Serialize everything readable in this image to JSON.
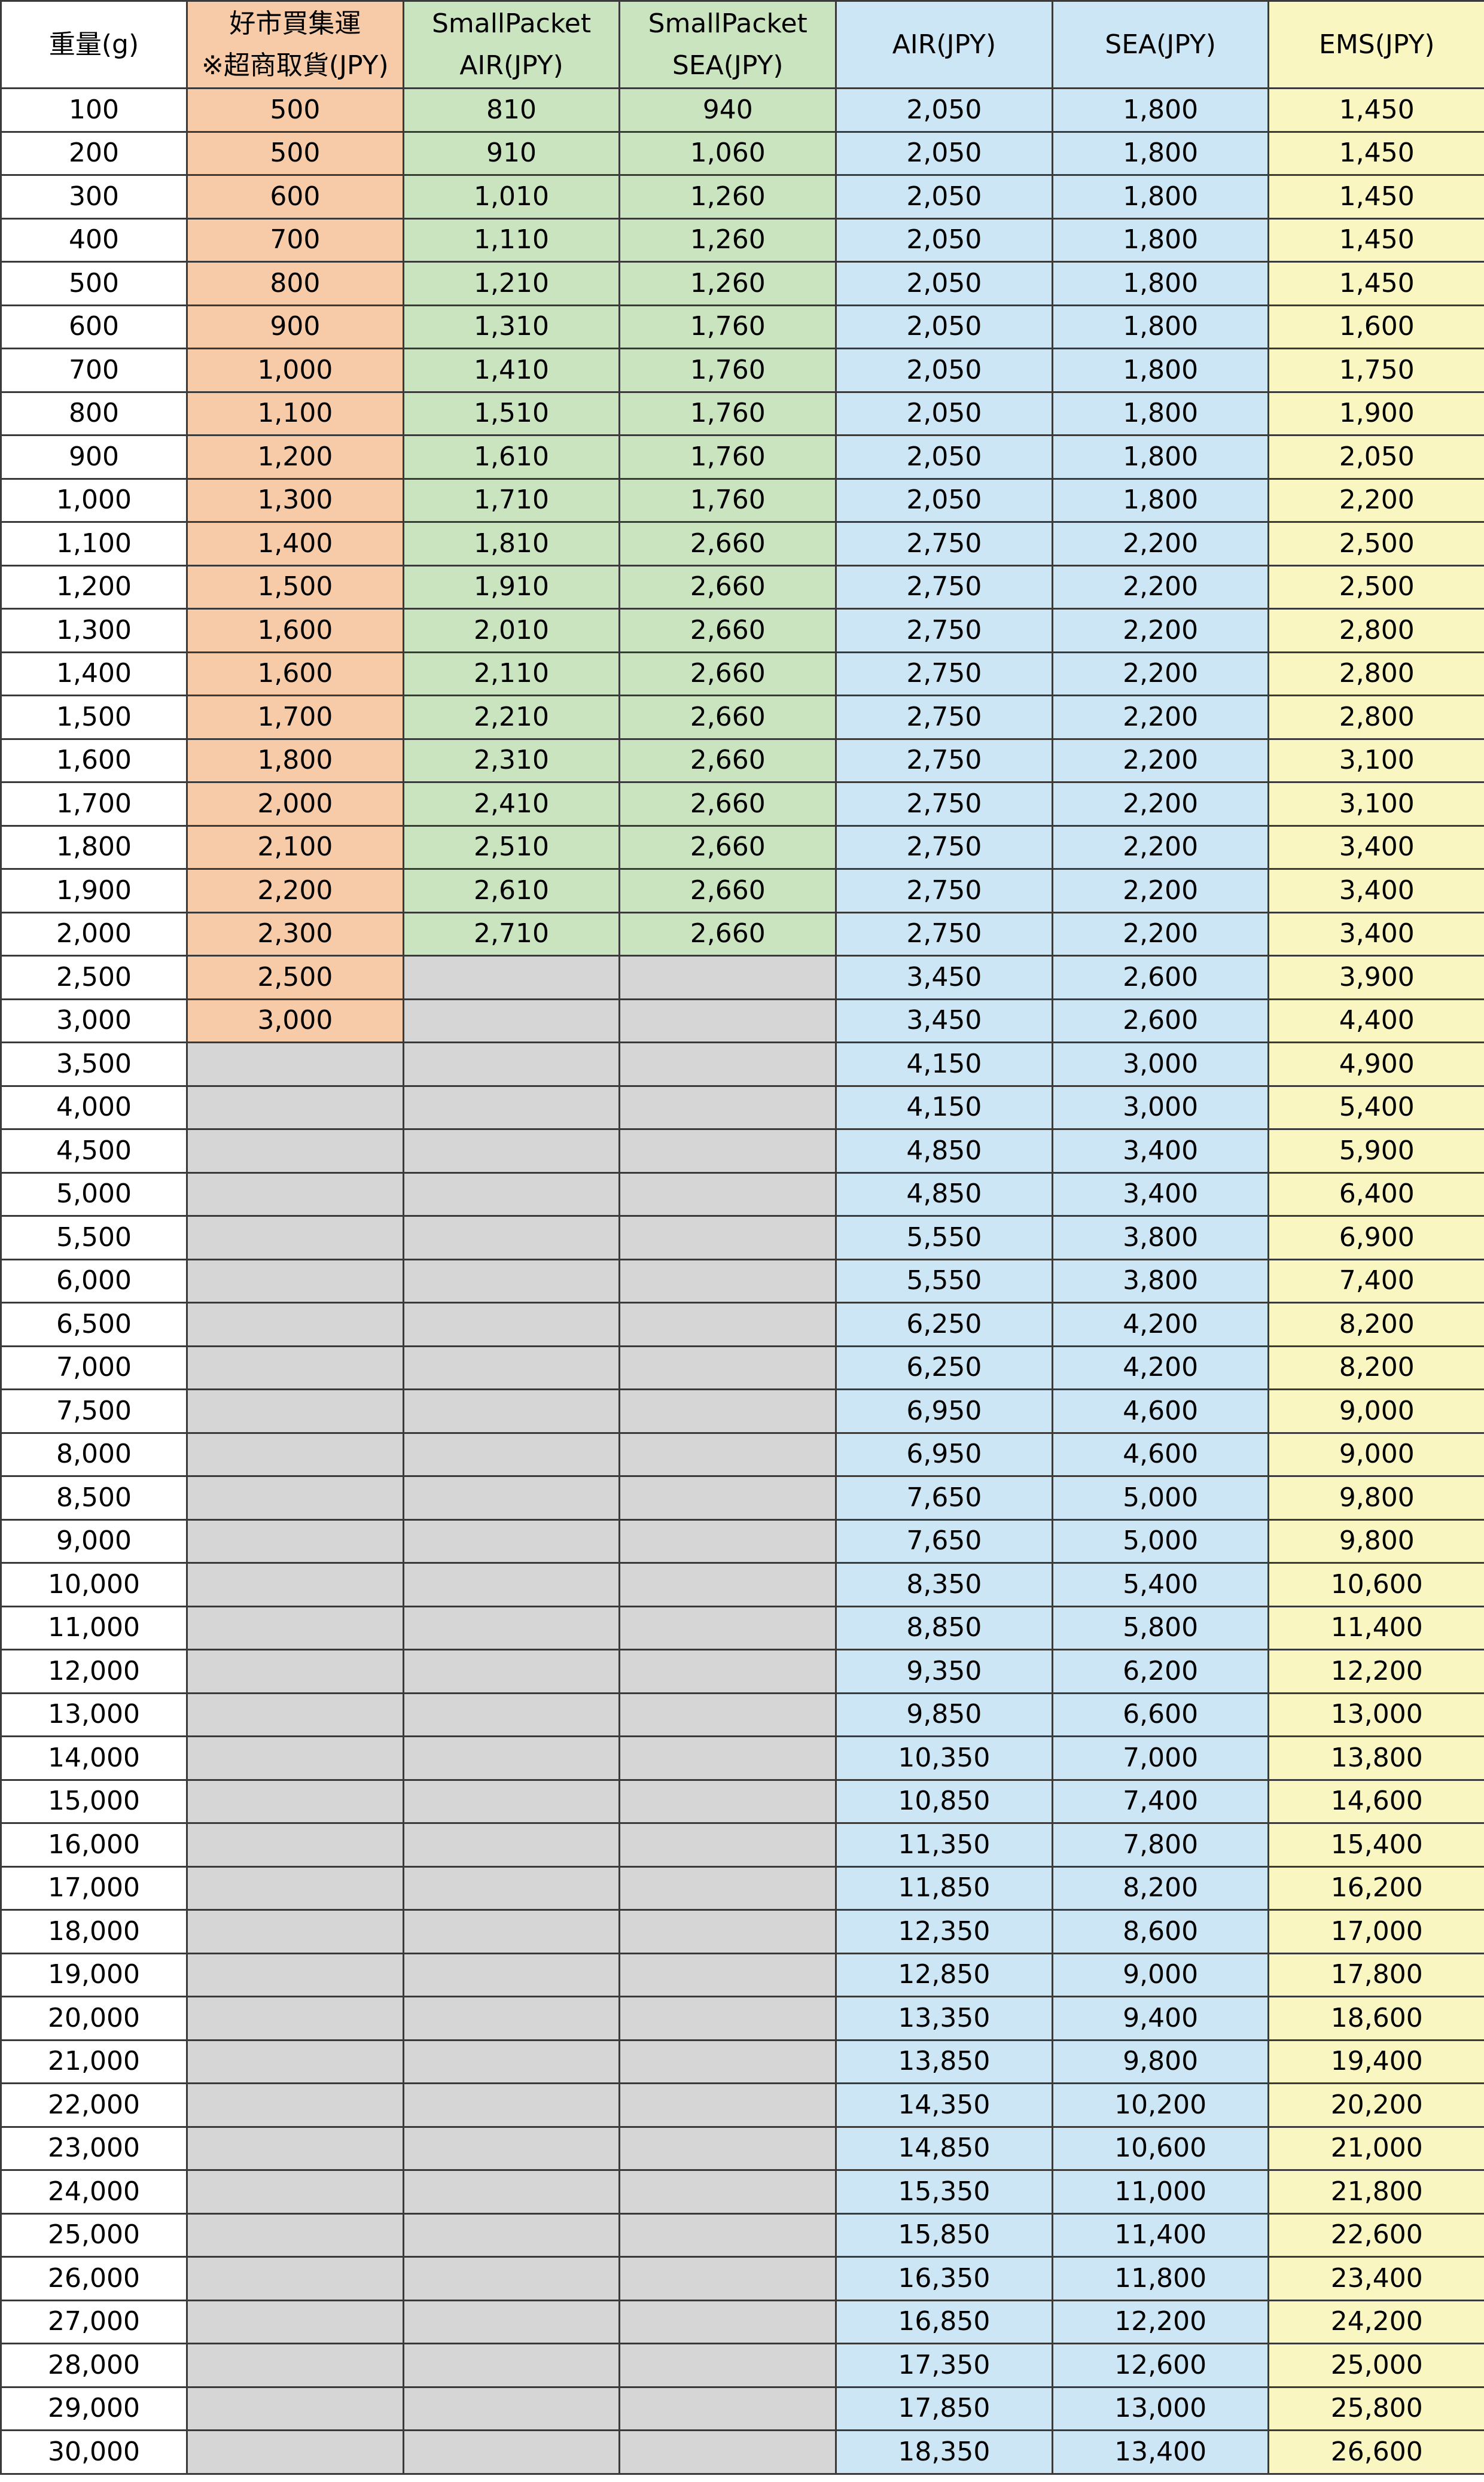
{
  "header": {
    "weight": "重量(g)",
    "costco_line1": "好市買集運",
    "costco_line2": "※超商取貨(JPY)",
    "sp_air_line1": "SmallPacket",
    "sp_air_line2": "AIR(JPY)",
    "sp_sea_line1": "SmallPacket",
    "sp_sea_line2": "SEA(JPY)",
    "air": "AIR(JPY)",
    "sea": "SEA(JPY)",
    "ems": "EMS(JPY)"
  },
  "colors": {
    "costco": "#f7cba7",
    "smallpacket": "#c9e4bf",
    "air_sea": "#cce6f5",
    "ems": "#f9f6c2",
    "unavailable": "#d6d6d6"
  },
  "rows": [
    [
      "100",
      "500",
      "810",
      "940",
      "2,050",
      "1,800",
      "1,450"
    ],
    [
      "200",
      "500",
      "910",
      "1,060",
      "2,050",
      "1,800",
      "1,450"
    ],
    [
      "300",
      "600",
      "1,010",
      "1,260",
      "2,050",
      "1,800",
      "1,450"
    ],
    [
      "400",
      "700",
      "1,110",
      "1,260",
      "2,050",
      "1,800",
      "1,450"
    ],
    [
      "500",
      "800",
      "1,210",
      "1,260",
      "2,050",
      "1,800",
      "1,450"
    ],
    [
      "600",
      "900",
      "1,310",
      "1,760",
      "2,050",
      "1,800",
      "1,600"
    ],
    [
      "700",
      "1,000",
      "1,410",
      "1,760",
      "2,050",
      "1,800",
      "1,750"
    ],
    [
      "800",
      "1,100",
      "1,510",
      "1,760",
      "2,050",
      "1,800",
      "1,900"
    ],
    [
      "900",
      "1,200",
      "1,610",
      "1,760",
      "2,050",
      "1,800",
      "2,050"
    ],
    [
      "1,000",
      "1,300",
      "1,710",
      "1,760",
      "2,050",
      "1,800",
      "2,200"
    ],
    [
      "1,100",
      "1,400",
      "1,810",
      "2,660",
      "2,750",
      "2,200",
      "2,500"
    ],
    [
      "1,200",
      "1,500",
      "1,910",
      "2,660",
      "2,750",
      "2,200",
      "2,500"
    ],
    [
      "1,300",
      "1,600",
      "2,010",
      "2,660",
      "2,750",
      "2,200",
      "2,800"
    ],
    [
      "1,400",
      "1,600",
      "2,110",
      "2,660",
      "2,750",
      "2,200",
      "2,800"
    ],
    [
      "1,500",
      "1,700",
      "2,210",
      "2,660",
      "2,750",
      "2,200",
      "2,800"
    ],
    [
      "1,600",
      "1,800",
      "2,310",
      "2,660",
      "2,750",
      "2,200",
      "3,100"
    ],
    [
      "1,700",
      "2,000",
      "2,410",
      "2,660",
      "2,750",
      "2,200",
      "3,100"
    ],
    [
      "1,800",
      "2,100",
      "2,510",
      "2,660",
      "2,750",
      "2,200",
      "3,400"
    ],
    [
      "1,900",
      "2,200",
      "2,610",
      "2,660",
      "2,750",
      "2,200",
      "3,400"
    ],
    [
      "2,000",
      "2,300",
      "2,710",
      "2,660",
      "2,750",
      "2,200",
      "3,400"
    ],
    [
      "2,500",
      "2,500",
      "",
      "",
      "3,450",
      "2,600",
      "3,900"
    ],
    [
      "3,000",
      "3,000",
      "",
      "",
      "3,450",
      "2,600",
      "4,400"
    ],
    [
      "3,500",
      "",
      "",
      "",
      "4,150",
      "3,000",
      "4,900"
    ],
    [
      "4,000",
      "",
      "",
      "",
      "4,150",
      "3,000",
      "5,400"
    ],
    [
      "4,500",
      "",
      "",
      "",
      "4,850",
      "3,400",
      "5,900"
    ],
    [
      "5,000",
      "",
      "",
      "",
      "4,850",
      "3,400",
      "6,400"
    ],
    [
      "5,500",
      "",
      "",
      "",
      "5,550",
      "3,800",
      "6,900"
    ],
    [
      "6,000",
      "",
      "",
      "",
      "5,550",
      "3,800",
      "7,400"
    ],
    [
      "6,500",
      "",
      "",
      "",
      "6,250",
      "4,200",
      "8,200"
    ],
    [
      "7,000",
      "",
      "",
      "",
      "6,250",
      "4,200",
      "8,200"
    ],
    [
      "7,500",
      "",
      "",
      "",
      "6,950",
      "4,600",
      "9,000"
    ],
    [
      "8,000",
      "",
      "",
      "",
      "6,950",
      "4,600",
      "9,000"
    ],
    [
      "8,500",
      "",
      "",
      "",
      "7,650",
      "5,000",
      "9,800"
    ],
    [
      "9,000",
      "",
      "",
      "",
      "7,650",
      "5,000",
      "9,800"
    ],
    [
      "10,000",
      "",
      "",
      "",
      "8,350",
      "5,400",
      "10,600"
    ],
    [
      "11,000",
      "",
      "",
      "",
      "8,850",
      "5,800",
      "11,400"
    ],
    [
      "12,000",
      "",
      "",
      "",
      "9,350",
      "6,200",
      "12,200"
    ],
    [
      "13,000",
      "",
      "",
      "",
      "9,850",
      "6,600",
      "13,000"
    ],
    [
      "14,000",
      "",
      "",
      "",
      "10,350",
      "7,000",
      "13,800"
    ],
    [
      "15,000",
      "",
      "",
      "",
      "10,850",
      "7,400",
      "14,600"
    ],
    [
      "16,000",
      "",
      "",
      "",
      "11,350",
      "7,800",
      "15,400"
    ],
    [
      "17,000",
      "",
      "",
      "",
      "11,850",
      "8,200",
      "16,200"
    ],
    [
      "18,000",
      "",
      "",
      "",
      "12,350",
      "8,600",
      "17,000"
    ],
    [
      "19,000",
      "",
      "",
      "",
      "12,850",
      "9,000",
      "17,800"
    ],
    [
      "20,000",
      "",
      "",
      "",
      "13,350",
      "9,400",
      "18,600"
    ],
    [
      "21,000",
      "",
      "",
      "",
      "13,850",
      "9,800",
      "19,400"
    ],
    [
      "22,000",
      "",
      "",
      "",
      "14,350",
      "10,200",
      "20,200"
    ],
    [
      "23,000",
      "",
      "",
      "",
      "14,850",
      "10,600",
      "21,000"
    ],
    [
      "24,000",
      "",
      "",
      "",
      "15,350",
      "11,000",
      "21,800"
    ],
    [
      "25,000",
      "",
      "",
      "",
      "15,850",
      "11,400",
      "22,600"
    ],
    [
      "26,000",
      "",
      "",
      "",
      "16,350",
      "11,800",
      "23,400"
    ],
    [
      "27,000",
      "",
      "",
      "",
      "16,850",
      "12,200",
      "24,200"
    ],
    [
      "28,000",
      "",
      "",
      "",
      "17,350",
      "12,600",
      "25,000"
    ],
    [
      "29,000",
      "",
      "",
      "",
      "17,850",
      "13,000",
      "25,800"
    ],
    [
      "30,000",
      "",
      "",
      "",
      "18,350",
      "13,400",
      "26,600"
    ]
  ]
}
